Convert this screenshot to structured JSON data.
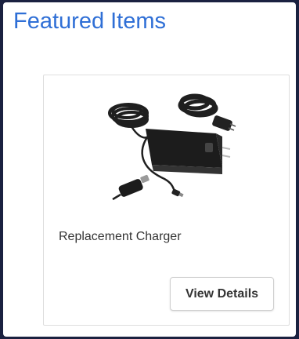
{
  "section": {
    "title": "Featured Items"
  },
  "product": {
    "name": "Replacement Charger",
    "image_icon": "laptop-charger-image",
    "button_label": "View Details"
  },
  "colors": {
    "title": "#2f6fd6",
    "frame": "#1a2140",
    "card_border": "#dedede"
  }
}
